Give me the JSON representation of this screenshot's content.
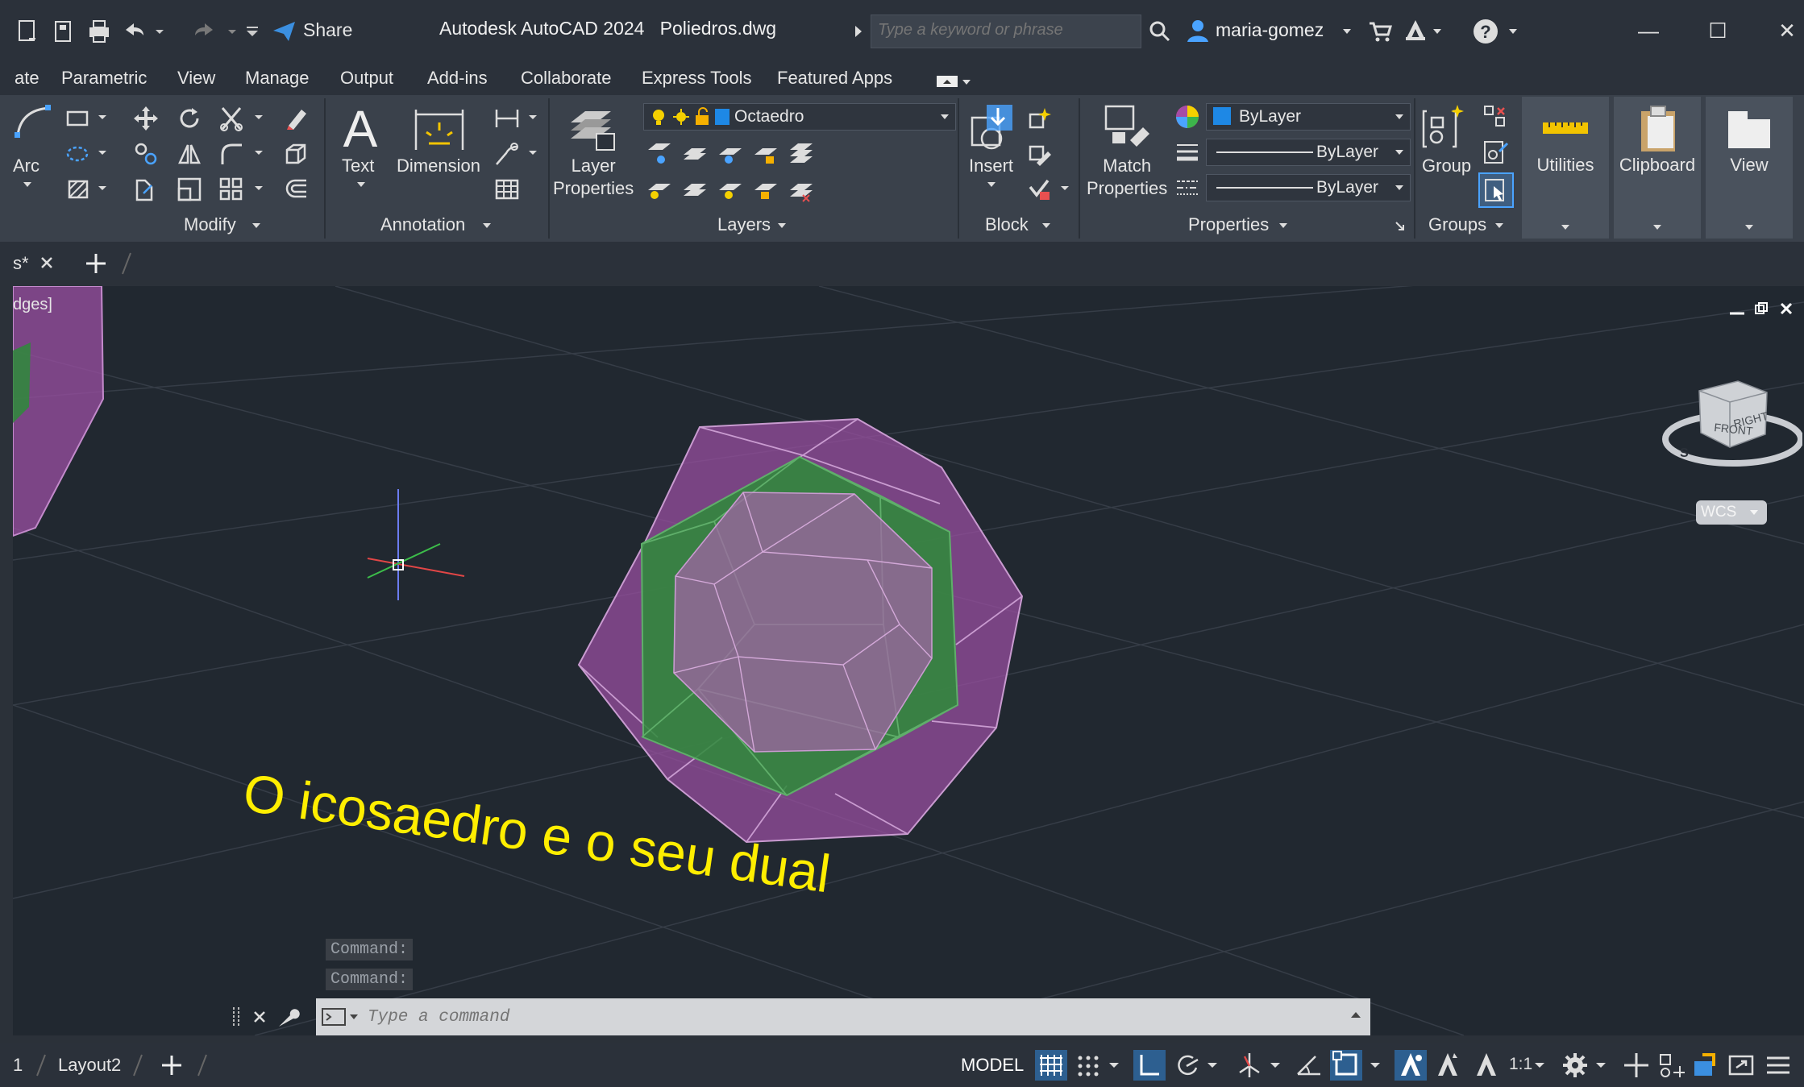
{
  "window": {
    "app_title": "Autodesk AutoCAD 2024",
    "file_name": "Poliedros.dwg",
    "share_label": "Share",
    "search_placeholder": "Type a keyword or phrase",
    "user_name": "maria-gomez"
  },
  "menu": [
    "ate",
    "Parametric",
    "View",
    "Manage",
    "Output",
    "Add-ins",
    "Collaborate",
    "Express Tools",
    "Featured Apps"
  ],
  "ribbon": {
    "draw_arc_label": "Arc",
    "modify_label": "Modify",
    "text_label": "Text",
    "dimension_label": "Dimension",
    "annotation_label": "Annotation",
    "layer_properties_label": "Layer\nProperties",
    "layer_current": "Octaedro",
    "layers_label": "Layers",
    "insert_label": "Insert",
    "block_label": "Block",
    "match_properties_label": "Match\nProperties",
    "color_value": "ByLayer",
    "lineweight_value": "ByLayer",
    "linetype_value": "ByLayer",
    "properties_label": "Properties",
    "group_label": "Group",
    "groups_label": "Groups",
    "utilities_label": "Utilities",
    "clipboard_label": "Clipboard",
    "view_label": "View"
  },
  "doc_tabs": {
    "active_tab": "s*"
  },
  "viewport": {
    "view_label": "dges]",
    "annotation_text": "O icosaedro e o seu dual",
    "viewcube_front": "FRONT",
    "viewcube_right": "RIGHT",
    "viewcube_south": "S",
    "wcs_label": "WCS",
    "command_history": [
      "Command:",
      "Command:"
    ],
    "command_placeholder": "Type a command"
  },
  "colors": {
    "accent": "#1e88e5",
    "outer_polyhedron": "#9b4fa3",
    "inner_polyhedron": "#2e8b3a",
    "annotation": "#ffee00"
  },
  "status": {
    "layout_tab_partial": "1",
    "layout2": "Layout2",
    "model": "MODEL",
    "scale": "1:1"
  }
}
